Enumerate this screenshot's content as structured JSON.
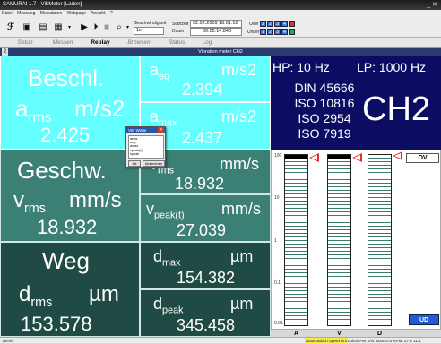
{
  "titlebar": {
    "title": "SAMURAI 1.7 - VibMeter [Laden]",
    "controls": "_ ✕"
  },
  "menu": [
    "Datei",
    "Messung",
    "Messdaten",
    "Webpage",
    "Ansicht",
    "?"
  ],
  "toolbar": {
    "range_label": "Geschwindigkeit",
    "range_value": "1x",
    "start_label": "Startzeit",
    "start_value": "02.02.2009  18:01:12",
    "elapsed_label": "Dauer",
    "elapsed_value": "00:00:14.840",
    "over_label": "Over",
    "under_label": "Under",
    "over_channels": [
      "1",
      "2",
      "3",
      "4"
    ],
    "under_channels": [
      "1",
      "2",
      "3",
      "4"
    ]
  },
  "tabs": [
    "Setup",
    "Messen",
    "Replay",
    "Browsen",
    "Status",
    "Log"
  ],
  "active_tab": "Replay",
  "view": {
    "number": "2",
    "title": "Vibration meter CH2"
  },
  "panels": {
    "beschl": {
      "title": "Beschl.",
      "rms_sym": "a",
      "rms_sub": "rms",
      "rms_unit": "m/s2",
      "rms_value": "2.425"
    },
    "aeq": {
      "sym": "a",
      "sub": "eq",
      "unit": "m/s2",
      "value": "2.394"
    },
    "amax": {
      "sym": "a",
      "sub": "max",
      "unit": "m/s2",
      "value": "2.437"
    },
    "geschw": {
      "title": "Geschw.",
      "rms_sym": "v",
      "rms_sub": "rms",
      "rms_unit": "mm/s",
      "rms_value": "18.932"
    },
    "vrms2": {
      "sym": "v",
      "sub": "rms",
      "unit": "mm/s",
      "value": "18.932"
    },
    "vpeak": {
      "sym": "v",
      "sub": "peak(t)",
      "unit": "mm/s",
      "value": "27.039"
    },
    "weg": {
      "title": "Weg",
      "rms_sym": "d",
      "rms_sub": "rms",
      "rms_unit": "µm",
      "rms_value": "153.578"
    },
    "dmax": {
      "sym": "d",
      "sub": "max",
      "unit": "µm",
      "value": "154.382"
    },
    "dpeak": {
      "sym": "d",
      "sub": "peak",
      "unit": "µm",
      "value": "345.458"
    }
  },
  "filter": {
    "hp": "HP: 10 Hz",
    "lp": "LP: 1000 Hz",
    "standards": [
      "DIN 45666",
      "ISO 10816",
      "ISO 2954",
      "ISO 7919"
    ],
    "channel": "CH2"
  },
  "meter": {
    "y_ticks": [
      "100",
      "10",
      "1",
      "0.1",
      "0.01"
    ],
    "bars": [
      {
        "label": "A",
        "level": 0.98,
        "peak": true
      },
      {
        "label": "V",
        "level": 0.98,
        "peak": true
      },
      {
        "label": "D",
        "level": 0.98,
        "peak": false
      }
    ],
    "ov_label": "OV",
    "ud_label": "UD"
  },
  "dialog": {
    "title": "VIB Werte",
    "items": [
      "arms",
      "aeq",
      "amax",
      "vpeak(t)",
      "vpeak"
    ],
    "ok": "Ok",
    "cancel": "Abbrechen"
  },
  "statusbar": {
    "left": "Bereit",
    "highlight": "Automatisch Speichern",
    "right": "Lofttvib-W  S/N: 5000-0.0 RPM: 27% 11:1"
  },
  "colors": {
    "cyan": "#66ffff",
    "teal": "#3c7f75",
    "dark_teal": "#1f4b44",
    "navy": "#0c0c62",
    "marker": "#e03030",
    "ud": "#1e5bd8"
  }
}
